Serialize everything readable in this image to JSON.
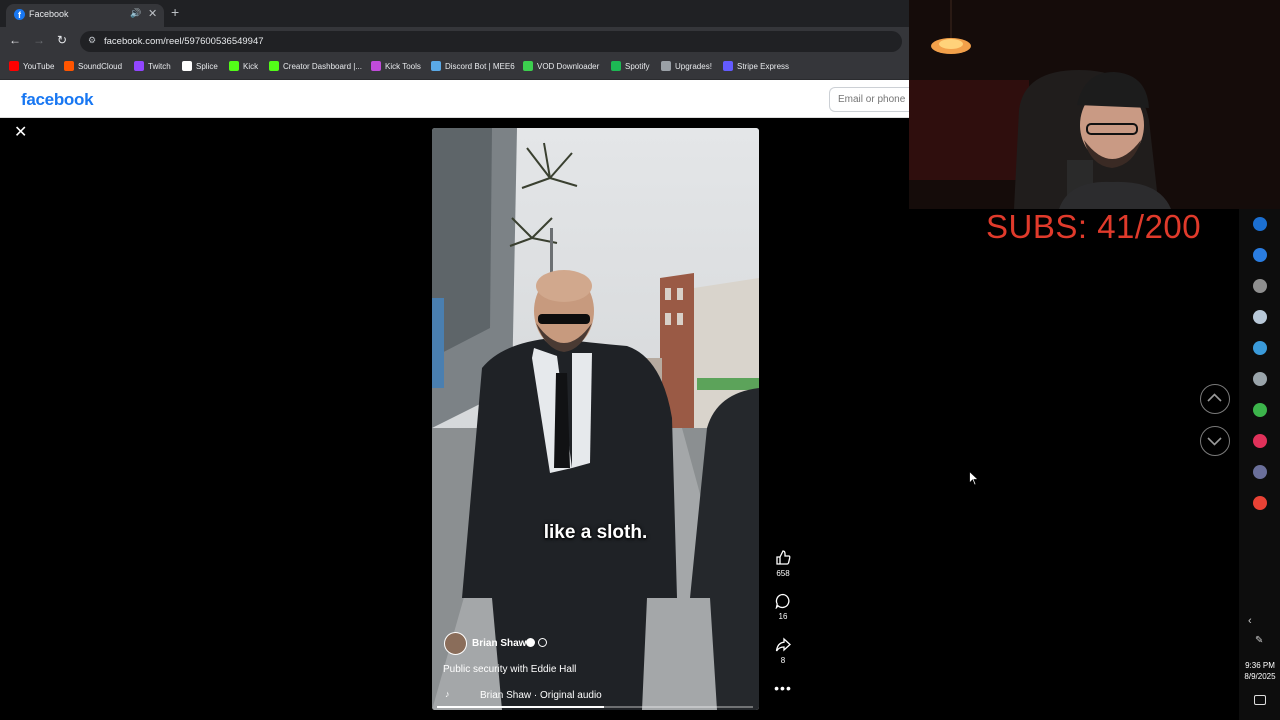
{
  "browser": {
    "tab_title": "Facebook",
    "url": "facebook.com/reel/597600536549947",
    "bookmarks": [
      {
        "label": "YouTube",
        "color": "#ff0000"
      },
      {
        "label": "SoundCloud",
        "color": "#ff5500"
      },
      {
        "label": "Twitch",
        "color": "#9146ff"
      },
      {
        "label": "Splice",
        "color": "#ffffff"
      },
      {
        "label": "Kick",
        "color": "#53fc18"
      },
      {
        "label": "Creator Dashboard |...",
        "color": "#53fc18"
      },
      {
        "label": "Kick Tools",
        "color": "#c04bd9"
      },
      {
        "label": "Discord Bot | MEE6",
        "color": "#5aa9e6"
      },
      {
        "label": "VOD Downloader",
        "color": "#3ccf4e"
      },
      {
        "label": "Spotify",
        "color": "#1db954"
      },
      {
        "label": "Upgrades!",
        "color": "#9aa0a6"
      },
      {
        "label": "Stripe Express",
        "color": "#635bff"
      }
    ]
  },
  "facebook": {
    "logo": "facebook",
    "email_placeholder": "Email or phone",
    "brand_color": "#1877f2"
  },
  "reel": {
    "caption": "like a sloth.",
    "author": "Brian Shaw",
    "description": "Public security with Eddie Hall",
    "audio": "Brian Shaw · Original audio",
    "progress": 0.53,
    "likes": "658",
    "comments": "16",
    "shares": "8"
  },
  "stream": {
    "subs_text": "SUBS: 41/200",
    "subs_color": "#e03a2b"
  },
  "taskbar": {
    "time": "9:36 PM",
    "date": "8/9/2025"
  }
}
